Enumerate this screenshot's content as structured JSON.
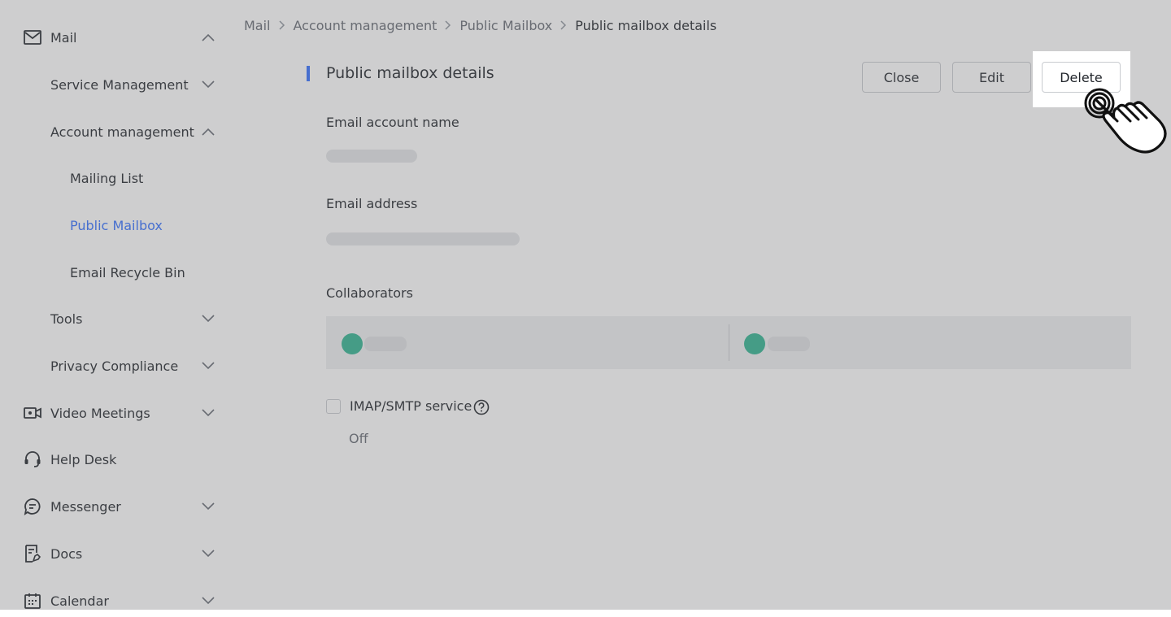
{
  "sidebar": {
    "items": [
      {
        "label": "Mail",
        "icon": "mail-icon",
        "expanded": true
      },
      {
        "label": "Service Management",
        "expanded": false
      },
      {
        "label": "Account management",
        "expanded": true
      },
      {
        "label": "Mailing List"
      },
      {
        "label": "Public Mailbox",
        "active": true
      },
      {
        "label": "Email Recycle Bin"
      },
      {
        "label": "Tools",
        "expanded": false
      },
      {
        "label": "Privacy Compliance",
        "expanded": false
      },
      {
        "label": "Video Meetings",
        "icon": "video-icon",
        "expanded": false
      },
      {
        "label": "Help Desk",
        "icon": "headset-icon"
      },
      {
        "label": "Messenger",
        "icon": "chat-icon",
        "expanded": false
      },
      {
        "label": "Docs",
        "icon": "docs-icon",
        "expanded": false
      },
      {
        "label": "Calendar",
        "icon": "calendar-icon",
        "expanded": false
      }
    ]
  },
  "breadcrumb": {
    "items": [
      "Mail",
      "Account management",
      "Public Mailbox"
    ],
    "current": "Public mailbox details"
  },
  "details": {
    "title": "Public mailbox details",
    "buttons": {
      "close": "Close",
      "edit": "Edit",
      "delete": "Delete"
    },
    "fields": {
      "account_name_label": "Email account name",
      "address_label": "Email address",
      "collaborators_label": "Collaborators"
    },
    "imap": {
      "label": "IMAP/SMTP service",
      "status": "Off"
    }
  },
  "colors": {
    "accent": "#3370ff",
    "avatar": "#2fb490"
  }
}
